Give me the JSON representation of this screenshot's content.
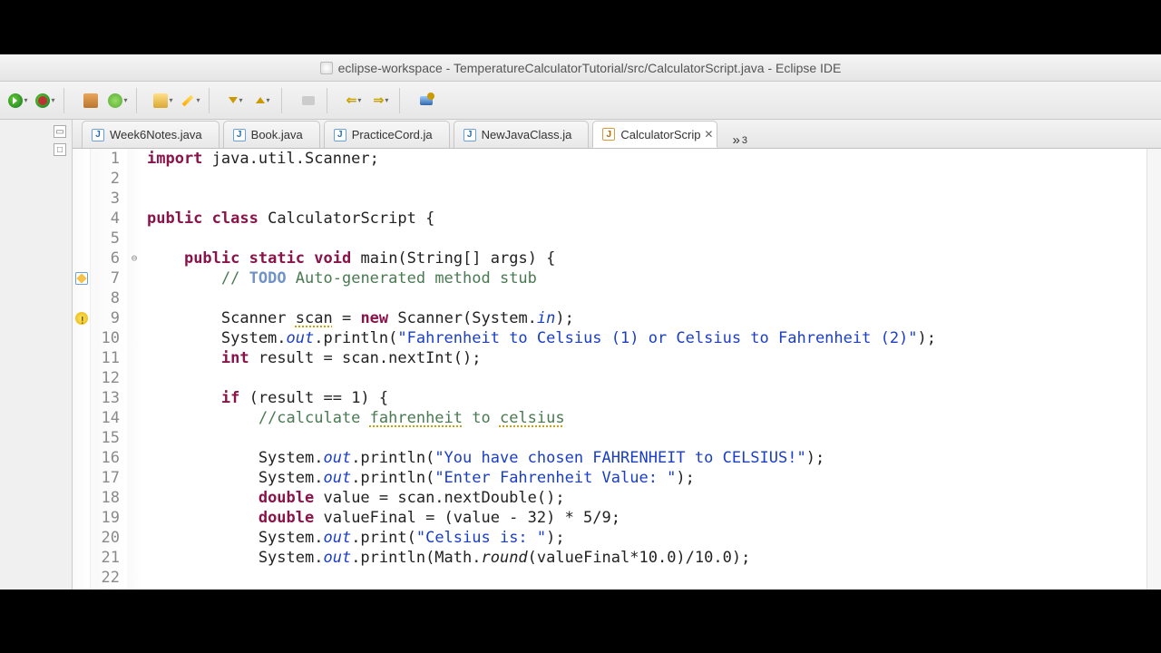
{
  "window": {
    "title": "eclipse-workspace - TemperatureCalculatorTutorial/src/CalculatorScript.java - Eclipse IDE"
  },
  "tabs": {
    "items": [
      {
        "label": "Week6Notes.java"
      },
      {
        "label": "Book.java"
      },
      {
        "label": "PracticeCord.ja"
      },
      {
        "label": "NewJavaClass.ja"
      },
      {
        "label": "CalculatorScrip"
      }
    ],
    "more_indicator": "»",
    "more_count": "3"
  },
  "toolbar": {
    "buttons": [
      "run-button",
      "debug-button",
      "new-package-button",
      "new-class-button",
      "open-folder-button",
      "search-wand-button",
      "step-into-button",
      "step-over-button",
      "step-return-button",
      "step-button",
      "nav-back-button",
      "nav-forward-button",
      "pin-editor-button"
    ]
  },
  "code": {
    "lines": [
      {
        "n": "1",
        "fold": "",
        "mk": "",
        "html": "<span class='kw'>import</span> java.util.Scanner;"
      },
      {
        "n": "2",
        "fold": "",
        "mk": "",
        "html": ""
      },
      {
        "n": "3",
        "fold": "",
        "mk": "",
        "html": ""
      },
      {
        "n": "4",
        "fold": "",
        "mk": "",
        "html": "<span class='kw'>public</span> <span class='kw'>class</span> CalculatorScript {"
      },
      {
        "n": "5",
        "fold": "",
        "mk": "",
        "html": ""
      },
      {
        "n": "6",
        "fold": "⊖",
        "mk": "",
        "html": "    <span class='kw'>public</span> <span class='kw'>static</span> <span class='kw'>void</span> main(String[] args) {"
      },
      {
        "n": "7",
        "fold": "",
        "mk": "edit",
        "html": "        <span class='com'>// <span class='todo'>TODO</span> Auto-generated method stub</span>"
      },
      {
        "n": "8",
        "fold": "",
        "mk": "",
        "html": ""
      },
      {
        "n": "9",
        "fold": "",
        "mk": "warn",
        "html": "        Scanner <span class='warn-underline'>scan</span> = <span class='kw'>new</span> Scanner(System.<span class='field'>in</span>);"
      },
      {
        "n": "10",
        "fold": "",
        "mk": "",
        "html": "        System.<span class='field'>out</span>.println(<span class='str'>\"Fahrenheit to Celsius (1) or Celsius to Fahrenheit (2)\"</span>);"
      },
      {
        "n": "11",
        "fold": "",
        "mk": "",
        "html": "        <span class='kw'>int</span> result = scan.nextInt();"
      },
      {
        "n": "12",
        "fold": "",
        "mk": "",
        "html": ""
      },
      {
        "n": "13",
        "fold": "",
        "mk": "",
        "html": "        <span class='kw'>if</span> (result == 1) {"
      },
      {
        "n": "14",
        "fold": "",
        "mk": "",
        "html": "            <span class='com'>//calculate <span class='spell'>fahrenheit</span> to <span class='spell'>celsius</span></span>"
      },
      {
        "n": "15",
        "fold": "",
        "mk": "",
        "html": ""
      },
      {
        "n": "16",
        "fold": "",
        "mk": "",
        "html": "            System.<span class='field'>out</span>.println(<span class='str'>\"You have chosen FAHRENHEIT to CELSIUS!\"</span>);"
      },
      {
        "n": "17",
        "fold": "",
        "mk": "",
        "html": "            System.<span class='field'>out</span>.println(<span class='str'>\"Enter Fahrenheit Value: \"</span>);"
      },
      {
        "n": "18",
        "fold": "",
        "mk": "",
        "html": "            <span class='kw'>double</span> value = scan.nextDouble();"
      },
      {
        "n": "19",
        "fold": "",
        "mk": "",
        "html": "            <span class='kw'>double</span> valueFinal = (value - 32) * 5/9;"
      },
      {
        "n": "20",
        "fold": "",
        "mk": "",
        "html": "            System.<span class='field'>out</span>.print(<span class='str'>\"Celsius is: \"</span>);"
      },
      {
        "n": "21",
        "fold": "",
        "mk": "",
        "html": "            System.<span class='field'>out</span>.println(Math.<span class='staticm'>round</span>(valueFinal*10.0)/10.0);"
      },
      {
        "n": "22",
        "fold": "",
        "mk": "",
        "html": ""
      }
    ]
  }
}
